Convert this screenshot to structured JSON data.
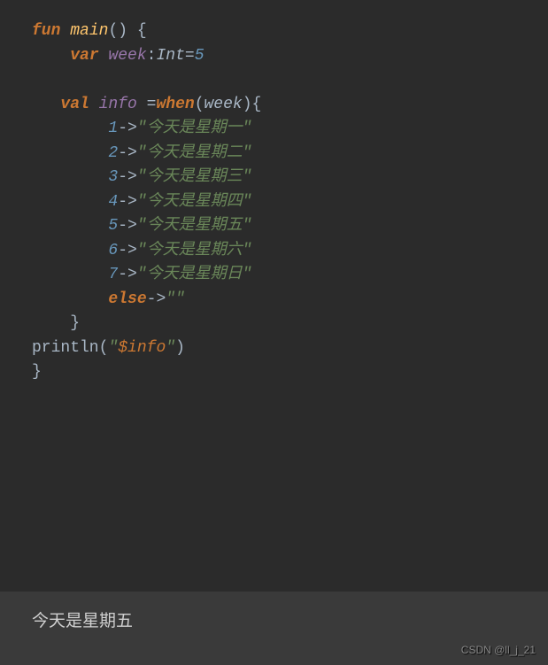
{
  "code": {
    "l1": {
      "kw_fun": "fun",
      "sp1": " ",
      "fn": "main",
      "paren": "() {"
    },
    "l2": {
      "indent": "    ",
      "kw_var": "var",
      "sp1": " ",
      "vname": "week",
      "colon": ":",
      "type": "Int",
      "eq": "=",
      "num": "5"
    },
    "l3": {
      "blank": ""
    },
    "l4": {
      "indent": "   ",
      "kw_val": "val",
      "sp1": " ",
      "vname": "info",
      "sp2": " ",
      "eq": "=",
      "kw_when": "when",
      "paren_l": "(",
      "arg": "week",
      "paren_r": ")",
      "brace": "{"
    },
    "l5": {
      "indent": "        ",
      "num": "1",
      "arrow": "->",
      "str": "\"今天是星期一\""
    },
    "l6": {
      "indent": "        ",
      "num": "2",
      "arrow": "->",
      "str": "\"今天是星期二\""
    },
    "l7": {
      "indent": "        ",
      "num": "3",
      "arrow": "->",
      "str": "\"今天是星期三\""
    },
    "l8": {
      "indent": "        ",
      "num": "4",
      "arrow": "->",
      "str": "\"今天是星期四\""
    },
    "l9": {
      "indent": "        ",
      "num": "5",
      "arrow": "->",
      "str": "\"今天是星期五\""
    },
    "l10": {
      "indent": "        ",
      "num": "6",
      "arrow": "->",
      "str": "\"今天是星期六\""
    },
    "l11": {
      "indent": "        ",
      "num": "7",
      "arrow": "->",
      "str": "\"今天是星期日\""
    },
    "l12": {
      "indent": "        ",
      "kw_else": "else",
      "arrow": "->",
      "str": "\"\""
    },
    "l13": {
      "indent": "    ",
      "brace": "}"
    },
    "l14": {
      "fn": "println",
      "paren_l": "(",
      "q1": "\"",
      "dollar": "$info",
      "q2": "\"",
      "paren_r": ")"
    },
    "l15": {
      "brace": "}"
    }
  },
  "output": {
    "text": "今天是星期五"
  },
  "watermark": "CSDN @ll_j_21"
}
